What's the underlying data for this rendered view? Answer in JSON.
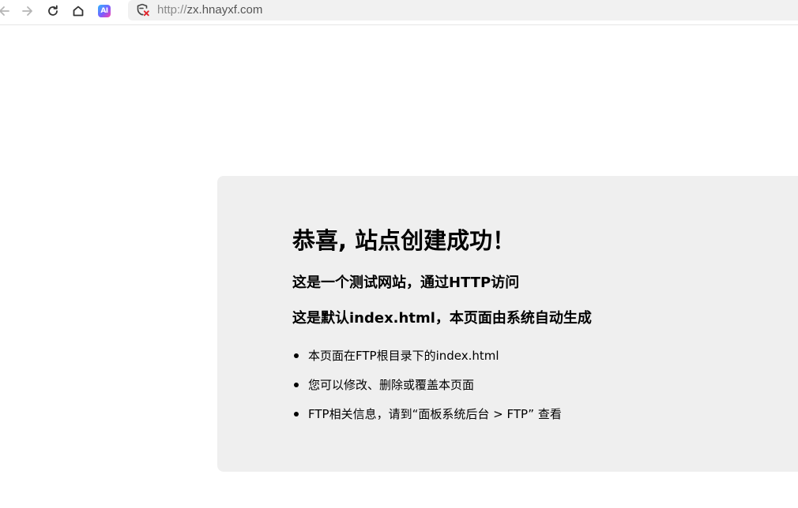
{
  "browser": {
    "url_protocol": "http://",
    "url_host": "zx.hnayxf.com",
    "ai_badge": "AI"
  },
  "page": {
    "title": "恭喜, 站点创建成功！",
    "subtitle1": "这是一个测试网站，通过HTTP访问",
    "subtitle2": "这是默认index.html，本页面由系统自动生成",
    "list": [
      "本页面在FTP根目录下的index.html",
      "您可以修改、删除或覆盖本页面",
      "FTP相关信息，请到“面板系统后台 > FTP” 查看"
    ]
  }
}
